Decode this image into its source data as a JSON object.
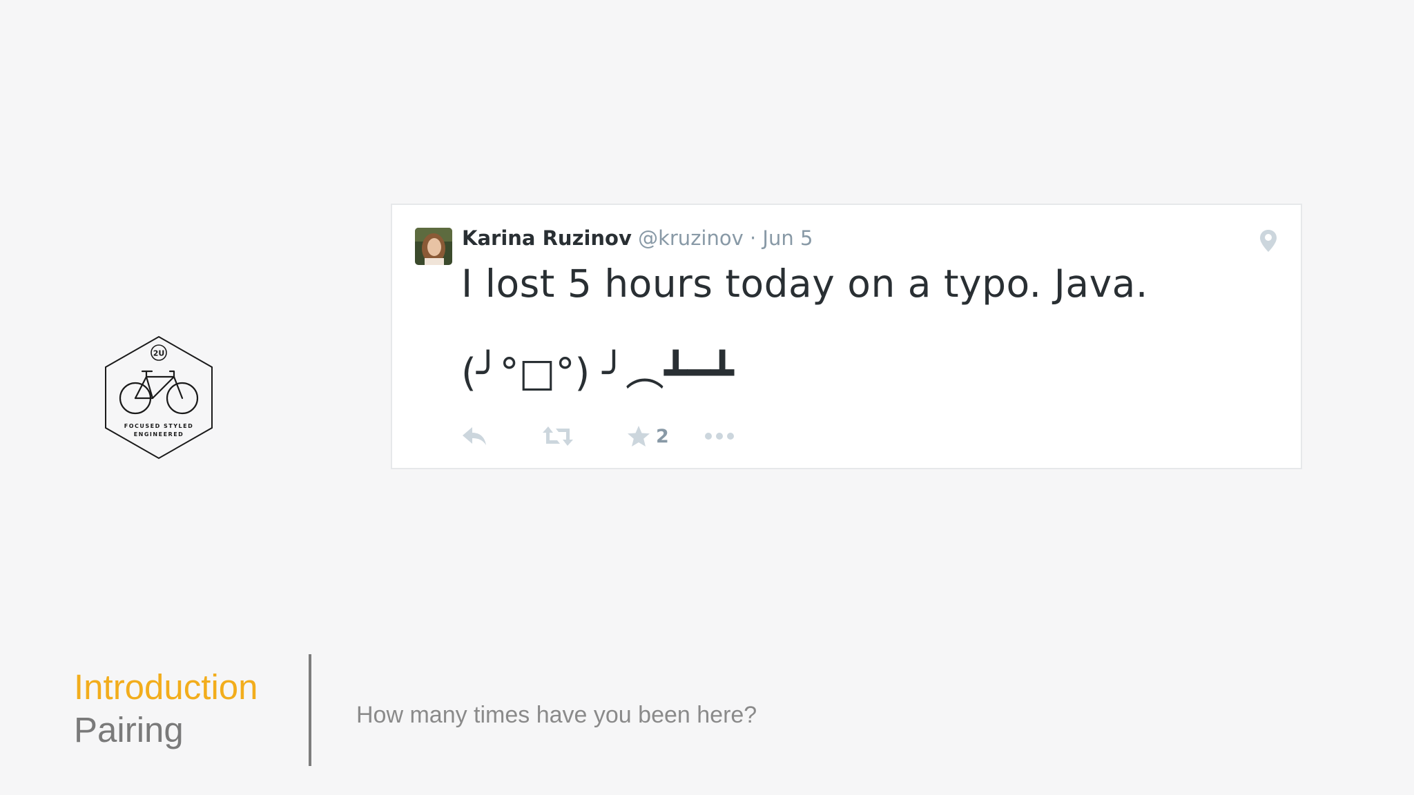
{
  "badge": {
    "logo_text": "2U",
    "line1": "FOCUSED  STYLED",
    "line2": "ENGINEERED"
  },
  "tweet": {
    "author_name": "Karina Ruzinov",
    "handle": "@kruzinov",
    "separator": "·",
    "date": "Jun 5",
    "text": "I lost 5 hours today on a typo. Java.",
    "emoticon": "(╯°□°) ╯︵┻━┻",
    "favorite_count": "2",
    "icons": {
      "location": "map-pin-icon",
      "reply": "reply-icon",
      "retweet": "retweet-icon",
      "favorite": "star-icon",
      "more": "more-dots-icon"
    }
  },
  "footer": {
    "section_title": "Introduction",
    "section_subtitle": "Pairing",
    "question": "How many times have you been here?"
  },
  "colors": {
    "background": "#f6f6f7",
    "accent": "#f2ad1c",
    "tweet_text": "#292f33",
    "tweet_muted": "#8899a6",
    "action_icon": "#ccd6dd"
  }
}
